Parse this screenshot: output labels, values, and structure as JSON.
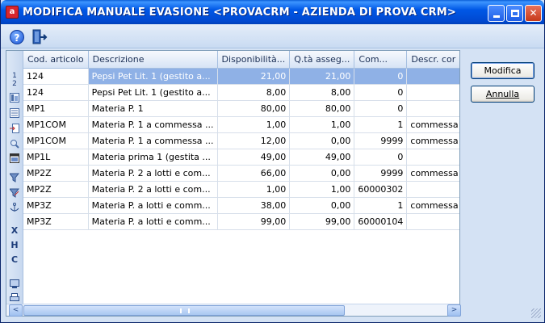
{
  "window": {
    "title": "MODIFICA MANUALE EVASIONE <PROVACRM - AZIENDA DI PROVA CRM>",
    "app_icon": "a-app-icon",
    "buttons": [
      "minimize",
      "maximize",
      "close"
    ]
  },
  "toolbar": {
    "help_icon": "question-icon",
    "exit_icon": "exit-door-icon"
  },
  "gutter": {
    "top_numbers": [
      "1",
      "2"
    ],
    "icons": [
      "columns-icon",
      "list-icon",
      "export-icon",
      "search-icon",
      "window-icon",
      "filter-icon",
      "filter-clear-icon",
      "anchor-icon",
      "x-marker",
      "h-marker",
      "c-marker",
      "monitor-icon",
      "printer-icon"
    ],
    "markers": {
      "x": "X",
      "h": "H",
      "c": "C"
    }
  },
  "grid": {
    "columns": [
      "Cod. articolo",
      "Descrizione",
      "Disponibilità...",
      "Q.tà asseg...",
      "Com...",
      "Descr. cor"
    ],
    "rows": [
      [
        "124",
        "Pepsi Pet Lit. 1 (gestito a...",
        "21,00",
        "21,00",
        "0",
        ""
      ],
      [
        "124",
        "Pepsi Pet Lit. 1 (gestito a...",
        "8,00",
        "8,00",
        "0",
        ""
      ],
      [
        "MP1",
        "Materia P. 1",
        "80,00",
        "80,00",
        "0",
        ""
      ],
      [
        "MP1COM",
        "Materia P. 1 a commessa ...",
        "1,00",
        "1,00",
        "1",
        "commessa"
      ],
      [
        "MP1COM",
        "Materia P. 1 a commessa ...",
        "12,00",
        "0,00",
        "9999",
        "commessa"
      ],
      [
        "MP1L",
        "Materia prima  1 (gestita ...",
        "49,00",
        "49,00",
        "0",
        ""
      ],
      [
        "MP2Z",
        "Materia P. 2 a lotti e com...",
        "66,00",
        "0,00",
        "9999",
        "commessa"
      ],
      [
        "MP2Z",
        "Materia P. 2 a lotti e com...",
        "1,00",
        "1,00",
        "60000302",
        ""
      ],
      [
        "MP3Z",
        "Materia P. a lotti e comm...",
        "38,00",
        "0,00",
        "1",
        "commessa"
      ],
      [
        "MP3Z",
        "Materia P. a lotti e comm...",
        "99,00",
        "99,00",
        "60000104",
        ""
      ]
    ],
    "selected_row": 0
  },
  "actions": {
    "modifica": "Modifica",
    "annulla": "Annulla"
  },
  "colors": {
    "title_bar": "#0058e6",
    "selection": "#8fb1e6",
    "window_bg": "#d4e2f4"
  }
}
